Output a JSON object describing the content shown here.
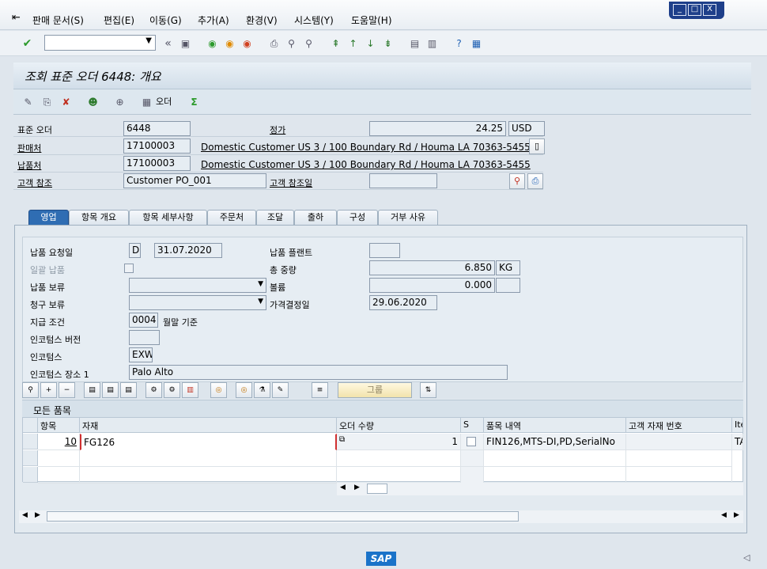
{
  "menu": {
    "items": [
      "판매 문서(S)",
      "편집(E)",
      "이동(G)",
      "추가(A)",
      "환경(V)",
      "시스템(Y)",
      "도움말(H)"
    ]
  },
  "window_controls": {
    "minimize": "_",
    "maximize": "□",
    "close": "X"
  },
  "toolbar": {
    "command_value": "",
    "back_symbol": "«"
  },
  "title": "조회 표준 오더 6448: 개요",
  "app_toolbar": {
    "order_button": "오더"
  },
  "header": {
    "std_order_label": "표준 오더",
    "std_order_value": "6448",
    "net_value_label": "정가",
    "net_value": "24.25",
    "currency": "USD",
    "sold_to_label": "판매처",
    "sold_to_value": "17100003",
    "sold_to_desc": "Domestic Customer US 3 / 100 Boundary Rd / Houma LA 70363-5455",
    "ship_to_label": "납품처",
    "ship_to_value": "17100003",
    "ship_to_desc": "Domestic Customer US 3 / 100 Boundary Rd / Houma LA 70363-5455",
    "cust_ref_label": "고객 참조",
    "cust_ref_value": "Customer PO_001",
    "cust_ref_date_label": "고객 참조일",
    "cust_ref_date_value": ""
  },
  "tabs": [
    {
      "label": "영업",
      "active": true
    },
    {
      "label": "항목 개요",
      "active": false
    },
    {
      "label": "항목 세부사항",
      "active": false
    },
    {
      "label": "주문처",
      "active": false
    },
    {
      "label": "조달",
      "active": false
    },
    {
      "label": "출하",
      "active": false
    },
    {
      "label": "구성",
      "active": false
    },
    {
      "label": "거부 사유",
      "active": false
    }
  ],
  "sales": {
    "req_deliv_date_label": "납품 요청일",
    "req_deliv_date_type": "D",
    "req_deliv_date": "31.07.2020",
    "deliv_plant_label": "납품 플랜트",
    "deliv_plant": "",
    "complete_dlv_label": "일괄 납품",
    "total_weight_label": "총 중량",
    "total_weight": "6.850",
    "weight_unit": "KG",
    "deliv_block_label": "납품 보류",
    "deliv_block": "",
    "volume_label": "볼륨",
    "volume": "0.000",
    "volume_unit": "",
    "billing_block_label": "청구 보류",
    "billing_block": "",
    "pricing_date_label": "가격결정일",
    "pricing_date": "29.06.2020",
    "payment_terms_label": "지급 조건",
    "payment_terms": "0004",
    "payment_terms_desc": "월말 기준",
    "inco_version_label": "인코텀스 버전",
    "inco_version": "",
    "incoterms_label": "인코텀스",
    "incoterms": "EXW",
    "inco_location_label": "인코텀스 장소 1",
    "inco_location": "Palo Alto"
  },
  "grid_toolbar": {
    "group_label": "그룹"
  },
  "items_grid": {
    "title": "모든 품목",
    "columns": [
      "항목",
      "자재",
      "오더 수량",
      "S",
      "품목 내역",
      "고객 자재 번호",
      "Ite"
    ],
    "rows": [
      {
        "item": "10",
        "material": "FG126",
        "qty": "1",
        "desc": "FIN126,MTS-DI,PD,SerialNo",
        "cust_mat": "",
        "ite": "TA"
      }
    ]
  },
  "footer": {
    "logo": "SAP"
  }
}
